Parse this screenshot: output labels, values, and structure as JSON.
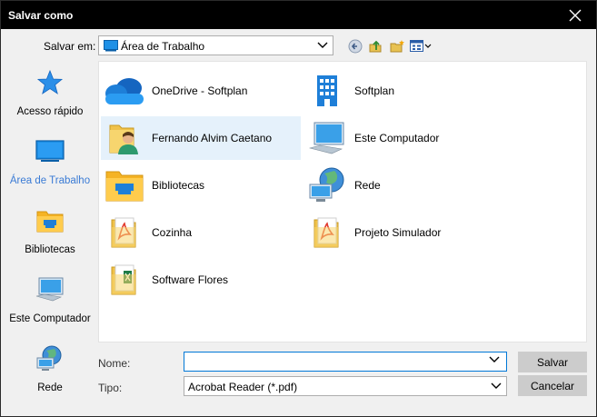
{
  "window": {
    "title": "Salvar como"
  },
  "lookin": {
    "label": "Salvar em:",
    "value": "Área de Trabalho"
  },
  "toolbar": {
    "back_icon": "back-icon",
    "up_icon": "up-folder-icon",
    "new_folder_icon": "new-folder-icon",
    "view_icon": "view-menu-icon"
  },
  "places": [
    {
      "label": "Acesso rápido",
      "icon": "star-icon"
    },
    {
      "label": "Área de Trabalho",
      "icon": "desktop-icon",
      "selected": true
    },
    {
      "label": "Bibliotecas",
      "icon": "libraries-icon"
    },
    {
      "label": "Este Computador",
      "icon": "computer-icon"
    },
    {
      "label": "Rede",
      "icon": "network-icon"
    }
  ],
  "files": [
    {
      "label": "OneDrive - Softplan",
      "icon": "onedrive-icon"
    },
    {
      "label": "Softplan",
      "icon": "building-icon"
    },
    {
      "label": "Fernando Alvim Caetano",
      "icon": "user-folder-icon",
      "selected": true
    },
    {
      "label": "Este Computador",
      "icon": "computer-icon"
    },
    {
      "label": "Bibliotecas",
      "icon": "libraries-icon"
    },
    {
      "label": "Rede",
      "icon": "network-icon"
    },
    {
      "label": "Cozinha",
      "icon": "pdf-folder-icon"
    },
    {
      "label": "Projeto Simulador",
      "icon": "pdf-folder-icon"
    },
    {
      "label": "Software Flores",
      "icon": "excel-folder-icon"
    }
  ],
  "form": {
    "name_label": "Nome:",
    "name_value": "",
    "type_label": "Tipo:",
    "type_value": "Acrobat Reader (*.pdf)"
  },
  "buttons": {
    "save": "Salvar",
    "cancel": "Cancelar"
  },
  "colors": {
    "titlebar": "#000000",
    "selection": "#e5f1fb",
    "accent": "#0078d7"
  }
}
